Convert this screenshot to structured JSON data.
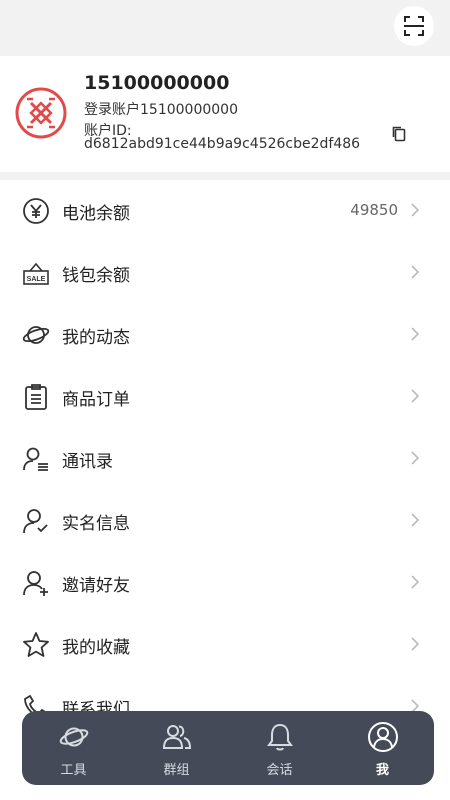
{
  "profile": {
    "name": "15100000000",
    "account_line": "登录账户15100000000",
    "id_label": "账户ID:",
    "id_value": "d6812abd91ce44b9a9c4526cbe2df486"
  },
  "menu": {
    "items": [
      {
        "label": "电池余额",
        "value": "49850",
        "icon": "yuan-icon"
      },
      {
        "label": "钱包余额",
        "icon": "sale-sign-icon"
      },
      {
        "label": "我的动态",
        "icon": "planet-icon"
      },
      {
        "label": "商品订单",
        "icon": "clipboard-icon"
      },
      {
        "label": "通讯录",
        "icon": "contacts-icon"
      },
      {
        "label": "实名信息",
        "icon": "user-check-icon"
      },
      {
        "label": "邀请好友",
        "icon": "user-add-icon"
      },
      {
        "label": "我的收藏",
        "icon": "star-icon"
      },
      {
        "label": "联系我们",
        "icon": "phone-icon"
      }
    ]
  },
  "tabs": [
    {
      "label": "工具",
      "icon": "planet-icon"
    },
    {
      "label": "群组",
      "icon": "group-icon"
    },
    {
      "label": "会话",
      "icon": "bell-icon"
    },
    {
      "label": "我",
      "icon": "user-circle-icon",
      "active": true
    }
  ],
  "colors": {
    "tabbar_bg": "#444a57",
    "avatar_red": "#e24a4a",
    "page_bg": "#f2f2f2"
  }
}
